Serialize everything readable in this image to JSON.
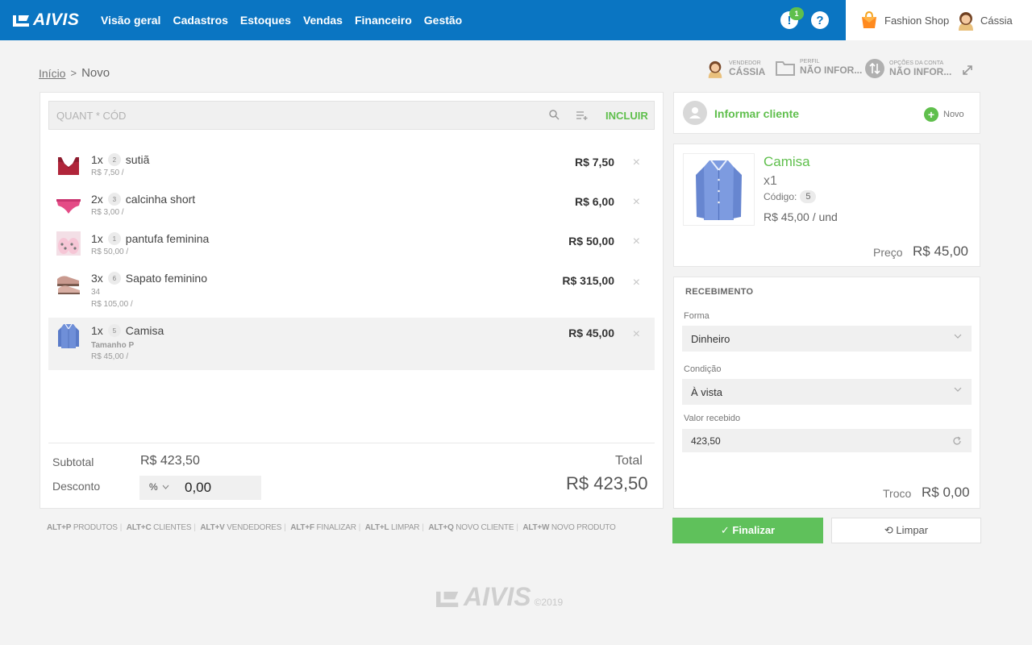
{
  "header": {
    "brand": "AIVIS",
    "nav": [
      "Visão geral",
      "Cadastros",
      "Estoques",
      "Vendas",
      "Financeiro",
      "Gestão"
    ],
    "notification_count": "1",
    "alert_glyph": "!",
    "help_glyph": "?",
    "shop_name": "Fashion Shop",
    "user_name": "Cássia"
  },
  "breadcrumb": {
    "home": "Início",
    "separator": ">",
    "current": "Novo"
  },
  "info_bar": {
    "seller_label": "VENDEDOR",
    "seller_value": "CÁSSIA",
    "profile_label": "PERFIL",
    "profile_value": "NÃO INFOR...",
    "account_label": "OPÇÕES DA CONTA",
    "account_value": "NÃO INFOR..."
  },
  "search": {
    "placeholder": "QUANT * CÓD",
    "include_label": "INCLUIR"
  },
  "items": [
    {
      "qty": "1x",
      "code": "2",
      "name": "sutiã",
      "variant": "",
      "unit_price": "R$ 7,50 /",
      "total": "R$ 7,50",
      "icon": "bra-icon"
    },
    {
      "qty": "2x",
      "code": "3",
      "name": "calcinha short",
      "variant": "",
      "unit_price": "R$ 3,00 /",
      "total": "R$ 6,00",
      "icon": "panty-icon"
    },
    {
      "qty": "1x",
      "code": "1",
      "name": "pantufa feminina",
      "variant": "",
      "unit_price": "R$ 50,00 /",
      "total": "R$ 50,00",
      "icon": "slipper-icon"
    },
    {
      "qty": "3x",
      "code": "6",
      "name": "Sapato feminino",
      "variant": "34",
      "unit_price": "R$ 105,00 /",
      "total": "R$ 315,00",
      "icon": "shoe-icon"
    },
    {
      "qty": "1x",
      "code": "5",
      "name": "Camisa",
      "variant": "Tamanho P",
      "unit_price": "R$ 45,00 /",
      "total": "R$ 45,00",
      "icon": "shirt-icon"
    }
  ],
  "remove_glyph": "×",
  "summary": {
    "subtotal_label": "Subtotal",
    "subtotal_value": "R$ 423,50",
    "discount_label": "Desconto",
    "discount_type": "%",
    "discount_value": "0,00",
    "total_label": "Total",
    "total_value": "R$ 423,50"
  },
  "shortcuts": [
    {
      "key": "ALT+P",
      "label": "PRODUTOS"
    },
    {
      "key": "ALT+C",
      "label": "CLIENTES"
    },
    {
      "key": "ALT+V",
      "label": "VENDEDORES"
    },
    {
      "key": "ALT+F",
      "label": "FINALIZAR"
    },
    {
      "key": "ALT+L",
      "label": "LIMPAR"
    },
    {
      "key": "ALT+Q",
      "label": "NOVO CLIENTE"
    },
    {
      "key": "ALT+W",
      "label": "NOVO PRODUTO"
    }
  ],
  "client": {
    "label": "Informar cliente",
    "new_label": "Novo",
    "new_glyph": "+"
  },
  "product": {
    "name": "Camisa",
    "qty": "x1",
    "code_label": "Código:",
    "code": "5",
    "unit_price": "R$ 45,00 / und",
    "price_label": "Preço",
    "price_value": "R$ 45,00"
  },
  "receipt": {
    "title": "RECEBIMENTO",
    "form_label": "Forma",
    "form_value": "Dinheiro",
    "condition_label": "Condição",
    "condition_value": "À vista",
    "amount_label": "Valor recebido",
    "amount_value": "423,50",
    "change_label": "Troco",
    "change_value": "R$ 0,00"
  },
  "actions": {
    "finish_label": "✓ Finalizar",
    "clear_label": "⟲ Limpar"
  },
  "footer": {
    "brand": "AIVIS",
    "copyright": "©2019"
  },
  "colors": {
    "primary": "#0a75c2",
    "accent_green": "#5fbf4c",
    "background": "#f3f3f3"
  }
}
